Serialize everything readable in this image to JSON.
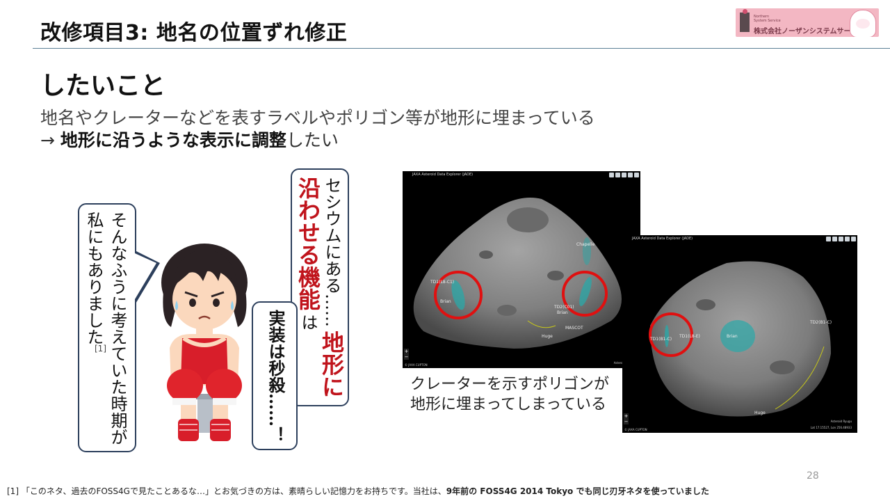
{
  "header": {
    "title": "改修項目3: 地名の位置ずれ修正",
    "logo_text": "株式会社ノーザンシステムサービス",
    "logo_small": "Northern\nSystem Service"
  },
  "main": {
    "heading": "したいこと",
    "line1": "地名やクレーターなどを表すラベルやポリゴン等が地形に埋まっている",
    "line2_prefix": "→ ",
    "line2_bold": "地形に沿うような表示に調整",
    "line2_suffix": "したい"
  },
  "bubbles": {
    "left_text": "そんなふうに考えていた時期が私にもありました",
    "left_footnote_ref": "[1]",
    "top_text_1": "セシウムにある……",
    "top_text_2": "地形に沿わせる機能",
    "top_text_3": "は",
    "mid_text": "実装は秒殺……！"
  },
  "screenshots": {
    "app_title": "JAXA Asteroid Data Explorer (JADE)",
    "app_footer": "© JAXA CUPTON",
    "footer_right": "Asteroid Ryugu",
    "shot1_labels": [
      "TD1(L8-C1)",
      "Brian",
      "Chapelle",
      "TD2(C01)",
      "Brian",
      "MASCOT",
      "Huge"
    ],
    "shot2_labels": [
      "TD2(B1-C)",
      "TD1(L8-E)",
      "Brian",
      "TD1(B1-C)",
      "Huge"
    ],
    "shot2_coords": "Lat 17.15527, Lon 256.48933",
    "caption": "クレーターを示すポリゴンが地形に埋まってしまっている"
  },
  "footer": {
    "page_number": "28",
    "footnote_normal": "[1] 「このネタ、過去のFOSS4Gで見たことあるな…」とお気づきの方は、素晴らしい記憶力をお持ちです。当社は、",
    "footnote_bold": "9年前の FOSS4G 2014 Tokyo でも同じ刃牙ネタを使っていました"
  },
  "colors": {
    "accent_red": "#c0141c",
    "bubble_border": "#2c3f5c",
    "rule": "#5b7f95",
    "highlight_circle": "#e01010",
    "polygon_fill": "#2aa8a8"
  }
}
